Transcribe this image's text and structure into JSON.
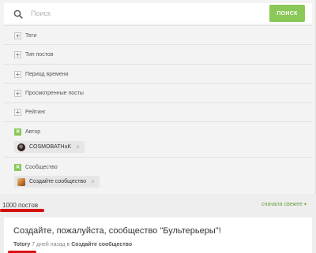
{
  "search": {
    "placeholder": "Поиск",
    "button_label": "ПОИСК"
  },
  "filters": [
    {
      "label": "Теги",
      "active": false
    },
    {
      "label": "Тип постов",
      "active": false
    },
    {
      "label": "Период времени",
      "active": false
    },
    {
      "label": "Просмотренные посты",
      "active": false
    },
    {
      "label": "Рейтинг",
      "active": false
    },
    {
      "label": "Автор",
      "active": true
    },
    {
      "label": "Сообщество",
      "active": true
    }
  ],
  "chips": {
    "author": {
      "label": "COSMOBATHuK",
      "remove": "×"
    },
    "community": {
      "label": "Создайте сообщество",
      "remove": "×"
    }
  },
  "results": {
    "count": "1000 постов",
    "sort_label": "сначала свежее",
    "sort_caret": "▾"
  },
  "post": {
    "title": "Создайте, пожалуйста, сообщество \"Бультерьеры\"!",
    "author": "Totory",
    "time": " 7 дней назад в ",
    "community": "Создайте сообщество"
  },
  "colors": {
    "accent": "#8ac858",
    "link": "#6aa33f",
    "marker": "#d51111"
  }
}
